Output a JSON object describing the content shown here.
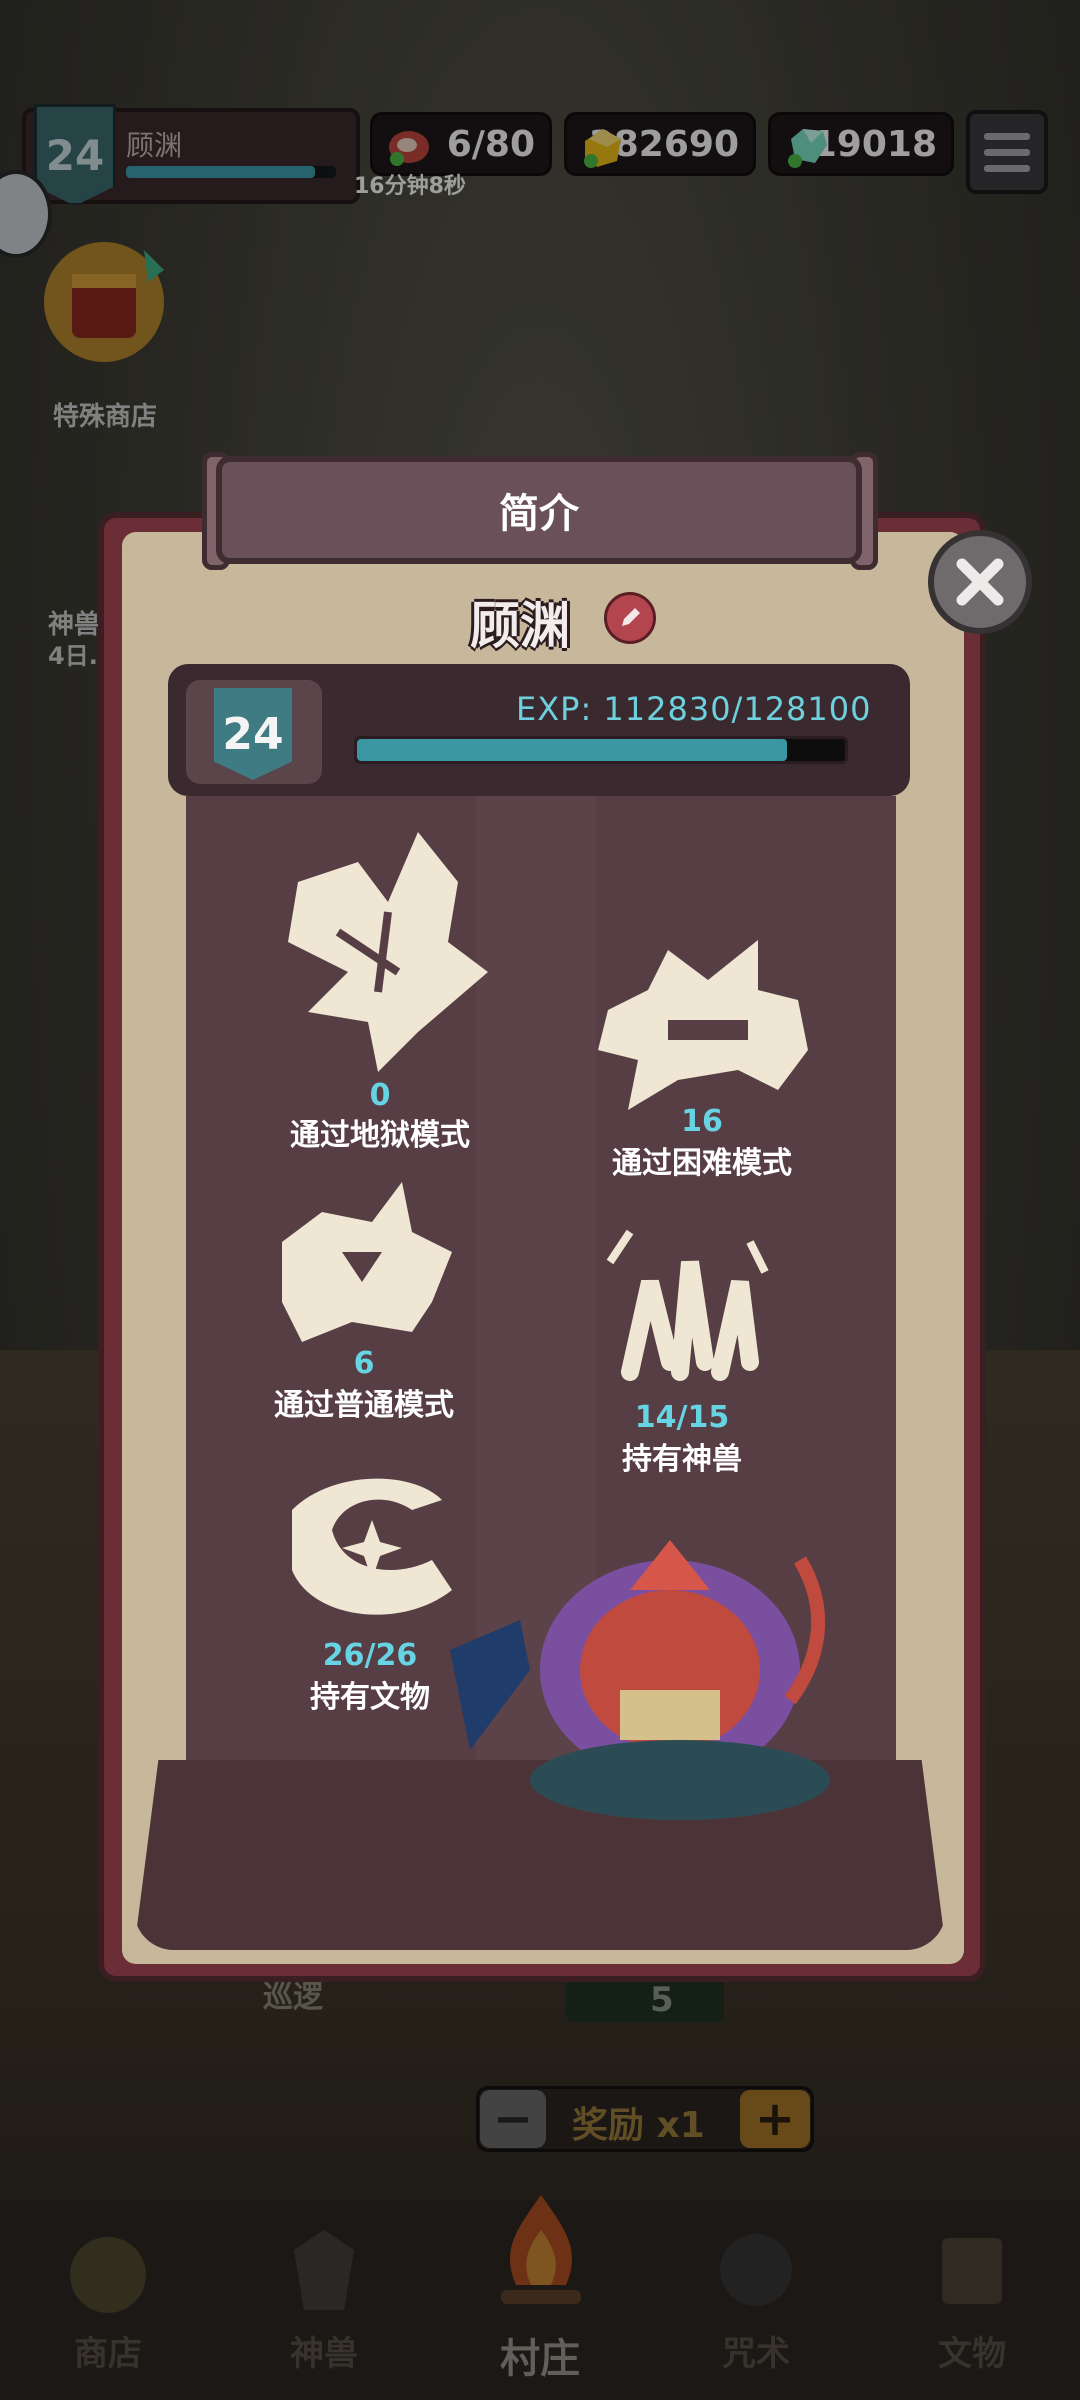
{
  "top_bar": {
    "level": "24",
    "player_name": "顾渊",
    "level_progress": 0.9,
    "stamina": "6/80",
    "stamina_timer": "16分钟8秒",
    "gold": "382690",
    "gems": "19018"
  },
  "side": {
    "special_shop_label": "特殊商店",
    "beast_label": "神兽",
    "beast_sub": "4日..."
  },
  "modal": {
    "title": "简介",
    "player_name": "顾渊",
    "level": "24",
    "exp_text": "EXP: 112830/128100",
    "exp_fraction": 0.881,
    "stats": [
      {
        "value": "0",
        "label": "通过地狱模式",
        "icon": "hell-mode-icon"
      },
      {
        "value": "16",
        "label": "通过困难模式",
        "icon": "hard-mode-icon"
      },
      {
        "value": "6",
        "label": "通过普通模式",
        "icon": "normal-mode-icon"
      },
      {
        "value": "14/15",
        "label": "持有神兽",
        "icon": "beast-claw-icon"
      },
      {
        "value": "26/26",
        "label": "持有文物",
        "icon": "artifact-icon"
      }
    ]
  },
  "behind": {
    "patrol_label": "巡逻",
    "cost_value": "5",
    "reward_label": "奖励 x1"
  },
  "tabs": [
    {
      "label": "商店",
      "icon": "shop-tab-icon",
      "active": false
    },
    {
      "label": "神兽",
      "icon": "beast-tab-icon",
      "active": false
    },
    {
      "label": "村庄",
      "icon": "campfire-icon",
      "active": true
    },
    {
      "label": "咒术",
      "icon": "spell-tab-icon",
      "active": false
    },
    {
      "label": "文物",
      "icon": "scroll-tab-icon",
      "active": false
    }
  ],
  "colors": {
    "modal_border": "#6b2e36",
    "panel": "#573e45",
    "accent_cyan": "#66d4e3"
  }
}
